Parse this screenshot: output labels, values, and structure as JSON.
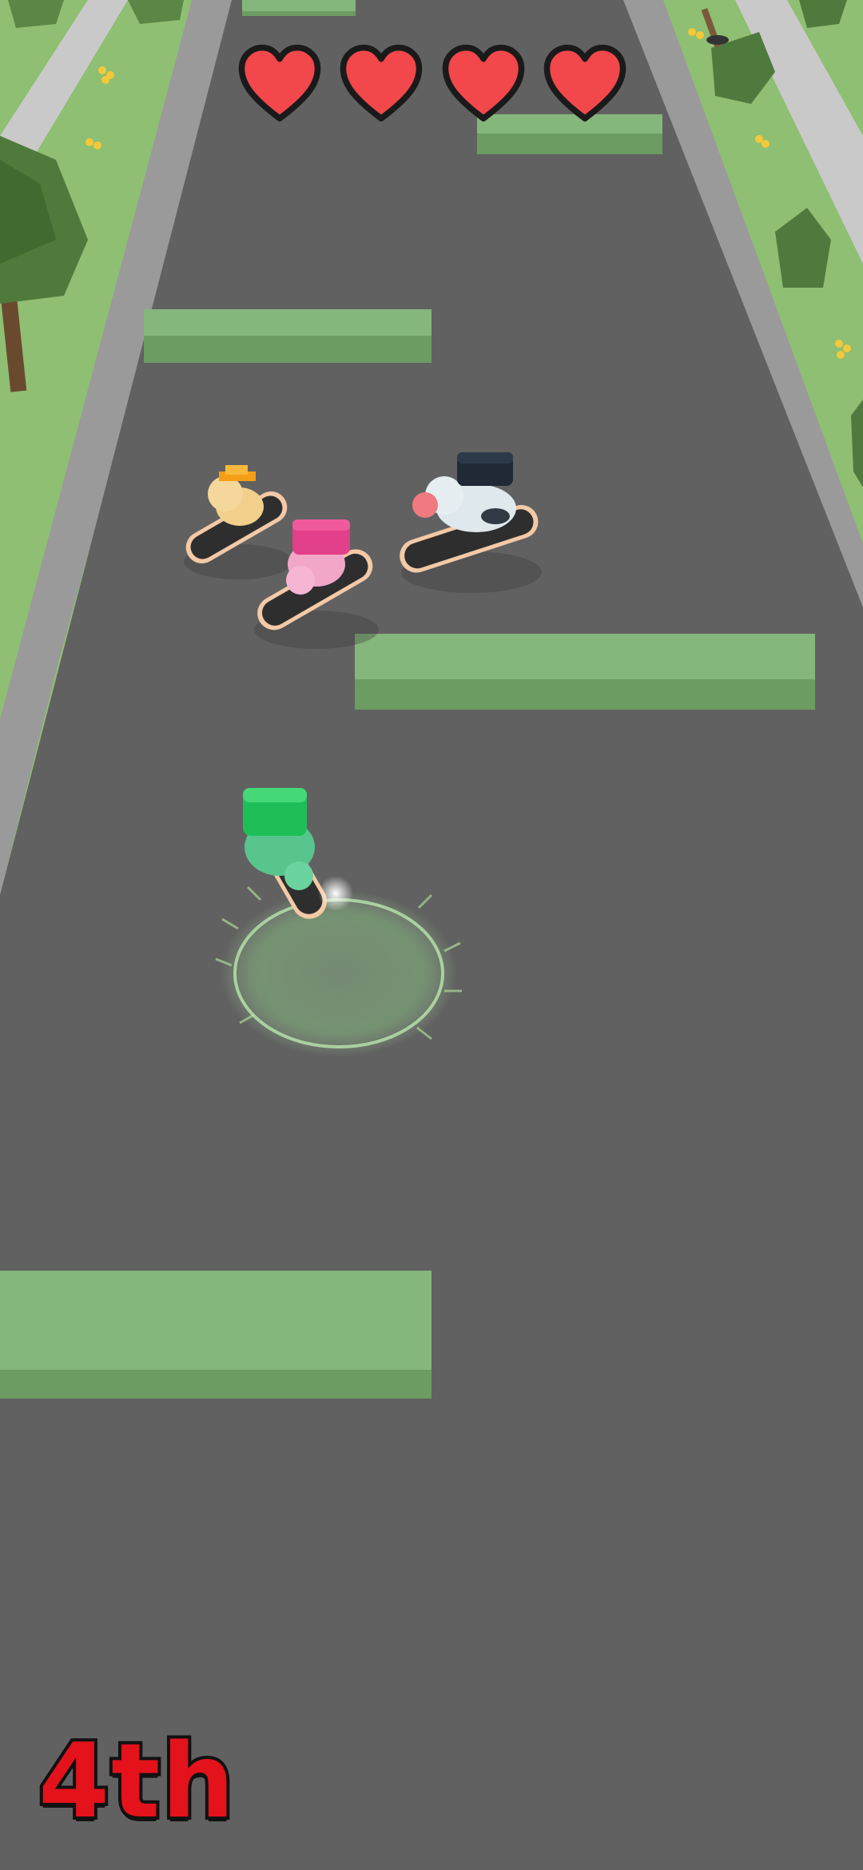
{
  "hud": {
    "lives": [
      "heart",
      "heart",
      "heart",
      "heart"
    ],
    "heart_color": "#f2474b",
    "position_label": "4th",
    "position_color": "#e3121b"
  },
  "scene": {
    "road_color": "#616161",
    "grass_color": "#8fbf72",
    "barrier_color": "#7fb373",
    "racers": [
      "dog-with-orange-hat",
      "pink-bunny",
      "cow-with-black-backpack",
      "player-green-turtle"
    ]
  }
}
